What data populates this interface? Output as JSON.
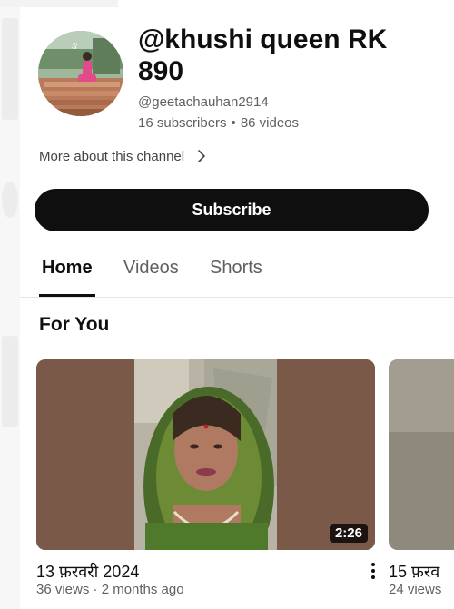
{
  "channel": {
    "name": "@khushi queen RK 890",
    "handle": "@geetachauhan2914",
    "subscribers": "16 subscribers",
    "separator": "•",
    "videos": "86 videos",
    "more_about": "More about this channel",
    "subscribe_label": "Subscribe"
  },
  "tabs": [
    {
      "label": "Home",
      "active": true
    },
    {
      "label": "Videos",
      "active": false
    },
    {
      "label": "Shorts",
      "active": false
    }
  ],
  "section": {
    "title": "For You"
  },
  "videos": [
    {
      "title": "13 फ़रवरी 2024",
      "meta": "36 views · 2 months ago",
      "duration": "2:26"
    },
    {
      "title": "15 फ़रव",
      "meta": "24 views"
    }
  ],
  "colors": {
    "subscribe_bg": "#0f0f0f",
    "active_tab": "#0f0f0f",
    "muted_text": "#606060"
  },
  "icons": {
    "more_about": "chevron-right-icon",
    "video_menu": "more-vert-icon"
  }
}
